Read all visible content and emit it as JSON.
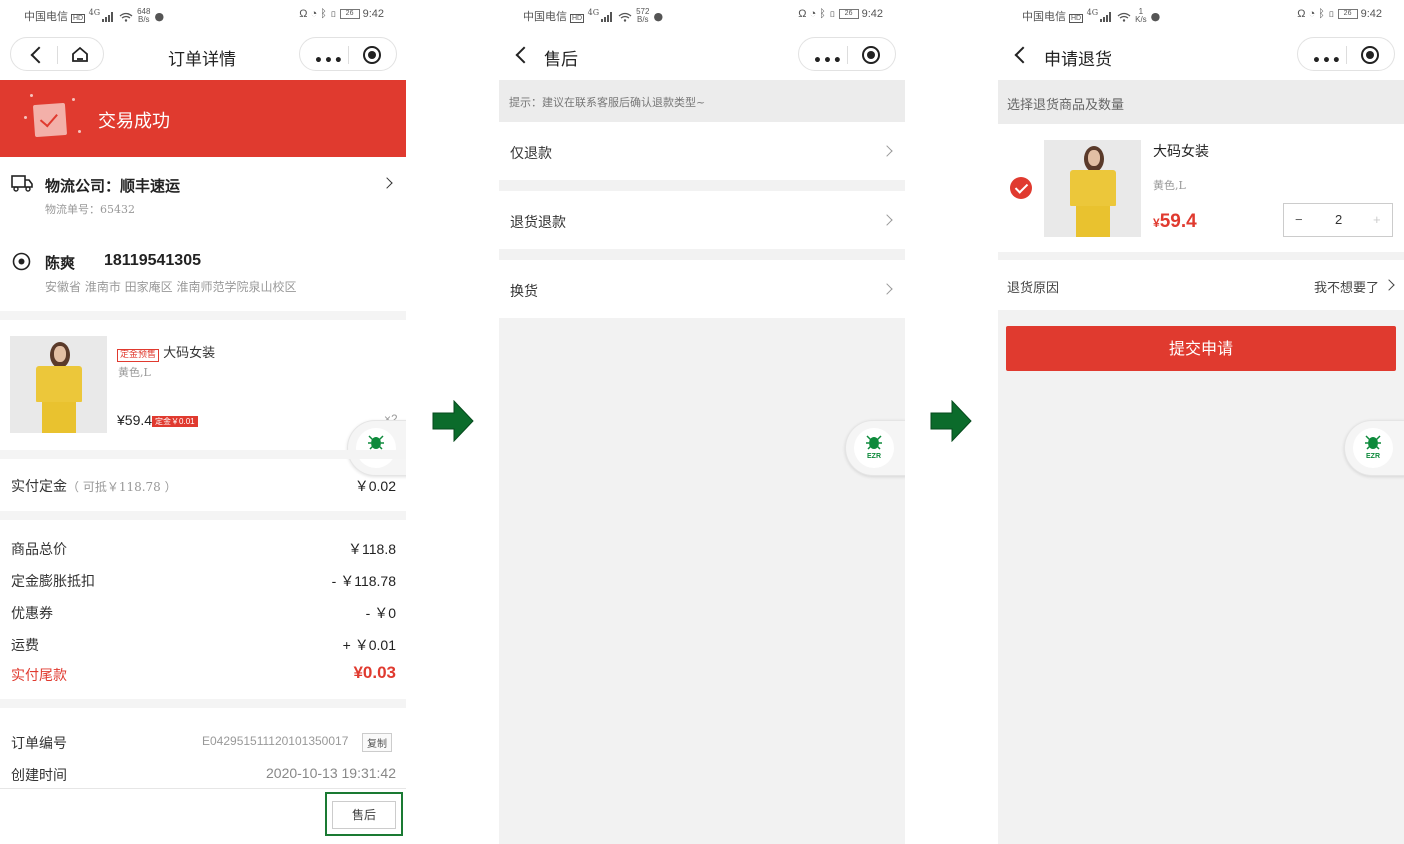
{
  "status_bar": {
    "s1": {
      "carrier": "中国电信",
      "hd": "HD",
      "net": "4G",
      "speed_value": "648",
      "speed_unit": "B/s",
      "battery": "26",
      "time": "9:42"
    },
    "s2": {
      "carrier": "中国电信",
      "hd": "HD",
      "net": "4G",
      "speed_value": "572",
      "speed_unit": "B/s",
      "battery": "26",
      "time": "9:42"
    },
    "s3": {
      "carrier": "中国电信",
      "hd": "HD",
      "net": "4G",
      "speed_value": "1",
      "speed_unit": "K/s",
      "battery": "26",
      "time": "9:42"
    }
  },
  "screen1": {
    "title": "订单详情",
    "more": "•••",
    "banner_text": "交易成功",
    "logistics_label": "物流公司：顺丰速运",
    "logistics_no": "物流单号：65432",
    "receiver_name": "陈爽",
    "receiver_phone": "18119541305",
    "receiver_address": "安徽省 淮南市 田家庵区 淮南师范学院泉山校区",
    "product_tag": "定金预售",
    "product_name": "大码女装",
    "product_spec": "黄色,L",
    "product_price": "¥59.4",
    "product_deposit_badge": "定金￥0.01",
    "product_qty": "×2",
    "deposit_label": "实付定金",
    "deposit_note": "（ 可抵￥118.78 ）",
    "deposit_value": "￥0.02",
    "lines": [
      {
        "label": "商品总价",
        "value": "￥118.8"
      },
      {
        "label": "定金膨胀抵扣",
        "value": "- ￥118.78"
      },
      {
        "label": "优惠券",
        "value": "- ￥0"
      },
      {
        "label": "运费",
        "value": "+ ￥0.01"
      }
    ],
    "final_label": "实付尾款",
    "final_value": "¥0.03",
    "order_no_label": "订单编号",
    "order_no": "E042951511120101350017",
    "copy_label": "复制",
    "created_label": "创建时间",
    "created_value": "2020-10-13 19:31:42",
    "aftersale_label": "售后"
  },
  "screen2": {
    "title": "售后",
    "more": "•••",
    "tip": "提示：建议在联系客服后确认退款类型~",
    "options": [
      "仅退款",
      "退货退款",
      "换货"
    ]
  },
  "screen3": {
    "title": "申请退货",
    "more": "•••",
    "section_head": "选择退货商品及数量",
    "product_name": "大码女装",
    "product_spec": "黄色,L",
    "price_symbol": "¥",
    "price": "59.4",
    "qty": "2",
    "minus": "−",
    "plus": "+",
    "reason_label": "退货原因",
    "reason_value": "我不想要了",
    "submit_label": "提交申请"
  },
  "float_logo": "EZR",
  "colors": {
    "accent": "#e03a2f",
    "highlight": "#1a7a33",
    "arrow": "#0b6b2b"
  }
}
